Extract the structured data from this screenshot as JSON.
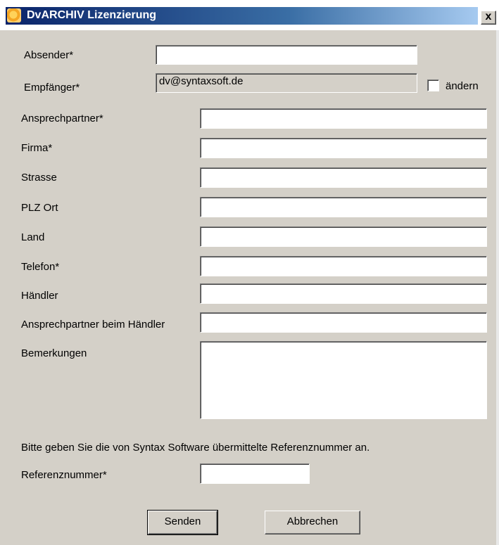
{
  "window": {
    "title": "DvARCHIV Lizenzierung",
    "close_label": "x"
  },
  "form": {
    "absender": {
      "label": "Absender*",
      "value": ""
    },
    "empfaenger": {
      "label": "Empfänger*",
      "value": "dv@syntaxsoft.de"
    },
    "aendern": {
      "label": "ändern",
      "checked": false
    },
    "ansprechpartner": {
      "label": "Ansprechpartner*",
      "value": ""
    },
    "firma": {
      "label": "Firma*",
      "value": ""
    },
    "strasse": {
      "label": "Strasse",
      "value": ""
    },
    "plz_ort": {
      "label": "PLZ Ort",
      "value": ""
    },
    "land": {
      "label": "Land",
      "value": ""
    },
    "telefon": {
      "label": "Telefon*",
      "value": ""
    },
    "haendler": {
      "label": "Händler",
      "value": ""
    },
    "ansprechpartner_haendler": {
      "label": "Ansprechpartner beim Händler",
      "value": ""
    },
    "bemerkungen": {
      "label": "Bemerkungen",
      "value": ""
    },
    "hint": "Bitte geben Sie die von Syntax Software übermittelte Referenznummer an.",
    "referenznummer": {
      "label": "Referenznummer*",
      "value": ""
    }
  },
  "buttons": {
    "send": "Senden",
    "cancel": "Abbrechen"
  },
  "icons": {
    "app": "dvarchiv-app-icon",
    "close": "close-icon"
  }
}
